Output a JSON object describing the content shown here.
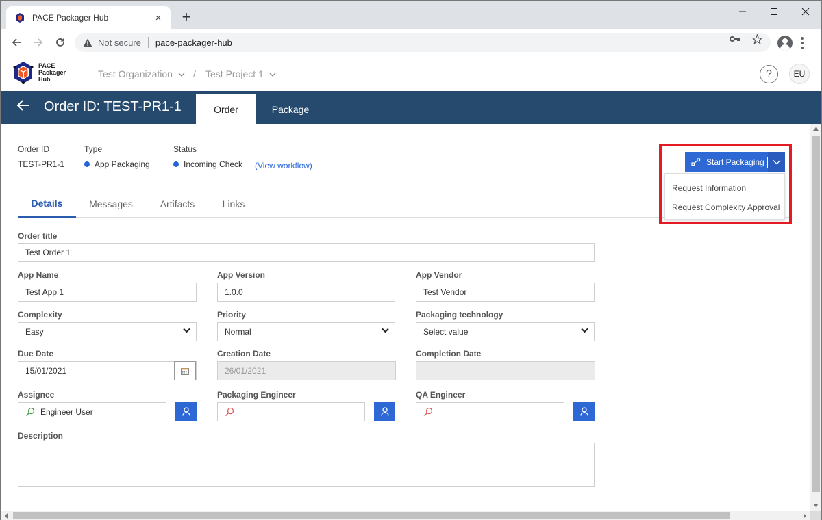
{
  "browser": {
    "tab_title": "PACE Packager Hub",
    "tab_close": "×",
    "new_tab": "+",
    "not_secure": "Not secure",
    "url": "pace-packager-hub"
  },
  "app": {
    "logo_line1": "PACE",
    "logo_line2": "Packager",
    "logo_line3": "Hub",
    "breadcrumb": [
      {
        "label": "Test Organization"
      },
      {
        "label": "Test Project 1"
      }
    ],
    "breadcrumb_sep": "/",
    "help": "?",
    "user_initials": "EU"
  },
  "orderbar": {
    "title": "Order ID: TEST-PR1-1",
    "tabs": [
      {
        "label": "Order",
        "active": true
      },
      {
        "label": "Package",
        "active": false
      }
    ]
  },
  "meta": {
    "order_id_label": "Order ID",
    "order_id_value": "TEST-PR1-1",
    "type_label": "Type",
    "type_value": "App Packaging",
    "status_label": "Status",
    "status_value": "Incoming Check",
    "view_workflow": "(View workflow)",
    "status_color": "#2563d6"
  },
  "subtabs": [
    {
      "label": "Details",
      "active": true
    },
    {
      "label": "Messages",
      "active": false
    },
    {
      "label": "Artifacts",
      "active": false
    },
    {
      "label": "Links",
      "active": false
    }
  ],
  "actions": {
    "start_packaging": "Start Packaging",
    "menu": [
      {
        "label": "Request Information"
      },
      {
        "label": "Request Complexity Approval"
      }
    ]
  },
  "form": {
    "order_title": {
      "label": "Order title",
      "value": "Test Order 1"
    },
    "app_name": {
      "label": "App Name",
      "value": "Test App 1"
    },
    "app_version": {
      "label": "App Version",
      "value": "1.0.0"
    },
    "app_vendor": {
      "label": "App Vendor",
      "value": "Test Vendor"
    },
    "complexity": {
      "label": "Complexity",
      "value": "Easy"
    },
    "priority": {
      "label": "Priority",
      "value": "Normal"
    },
    "packaging_technology": {
      "label": "Packaging technology",
      "value": "Select value"
    },
    "due_date": {
      "label": "Due Date",
      "value": "15/01/2021"
    },
    "creation_date": {
      "label": "Creation Date",
      "value": "26/01/2021"
    },
    "completion_date": {
      "label": "Completion Date",
      "value": ""
    },
    "assignee": {
      "label": "Assignee",
      "value": "Engineer User"
    },
    "packaging_engineer": {
      "label": "Packaging Engineer",
      "value": ""
    },
    "qa_engineer": {
      "label": "QA Engineer",
      "value": ""
    },
    "description": {
      "label": "Description",
      "value": ""
    }
  }
}
